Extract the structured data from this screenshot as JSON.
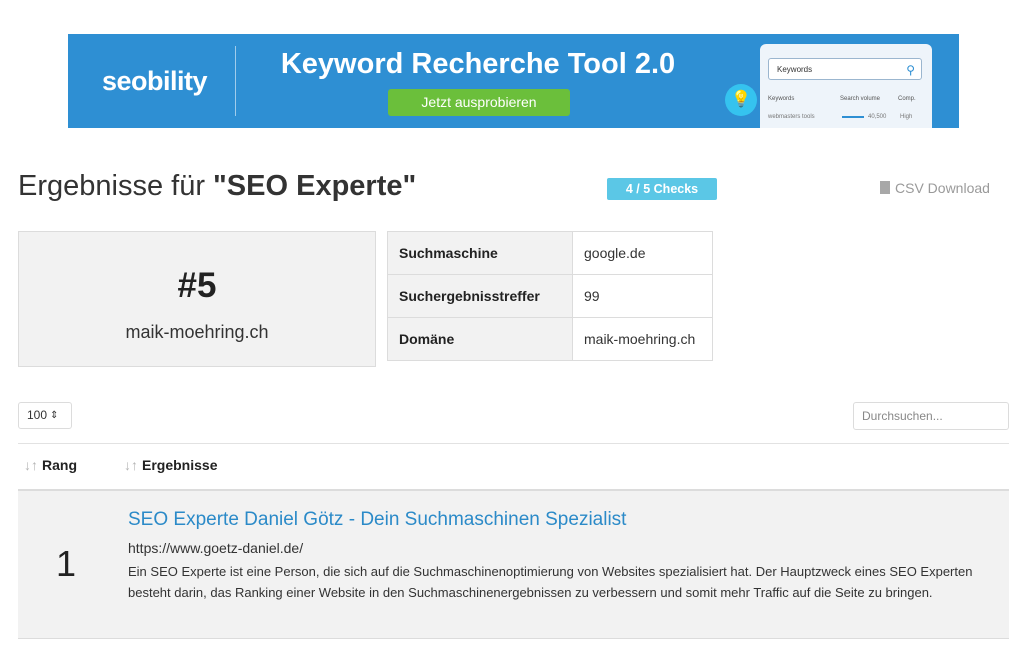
{
  "banner": {
    "logo": "seobility",
    "headline": "Keyword Recherche Tool  2.0",
    "cta": "Jetzt ausprobieren",
    "mock_search_placeholder": "Keywords",
    "mock_col_keywords": "Keywords",
    "mock_col_volume": "Search volume",
    "mock_col_comp": "Comp.",
    "mock_row_keyword": "webmasters tools",
    "mock_row_volume": "40,500",
    "mock_row_comp": "High",
    "bg_color": "#2e8fd3",
    "cta_color": "#6bbf3b"
  },
  "header": {
    "title_prefix": "Ergebnisse für ",
    "title_query": "\"SEO Experte\"",
    "checks_badge": "4 / 5 Checks",
    "csv_label": "CSV Download",
    "csv_icon": "file-icon"
  },
  "summary": {
    "position": "#5",
    "domain": "maik-moehring.ch"
  },
  "info_table": [
    {
      "key": "Suchmaschine",
      "value": "google.de"
    },
    {
      "key": "Suchergebnisstreffer",
      "value": "99"
    },
    {
      "key": "Domäne",
      "value": "maik-moehring.ch"
    }
  ],
  "controls": {
    "page_size": "100",
    "search_placeholder": "Durchsuchen..."
  },
  "results_table": {
    "columns": [
      "Rang",
      "Ergebnisse"
    ],
    "rows": [
      {
        "rank": "1",
        "title": "SEO Experte Daniel Götz - Dein Suchmaschinen Spezialist",
        "url": "https://www.goetz-daniel.de/",
        "description": "Ein SEO Experte ist eine Person, die sich auf die Suchmaschinenoptimierung von Websites spezialisiert hat. Der Hauptzweck eines SEO Experten besteht darin, das Ranking einer Website in den Suchmaschinenergebnissen zu verbessern und somit mehr Traffic auf die Seite zu bringen."
      }
    ]
  },
  "colors": {
    "accent": "#2b8ac8",
    "badge": "#5bc7e6"
  }
}
